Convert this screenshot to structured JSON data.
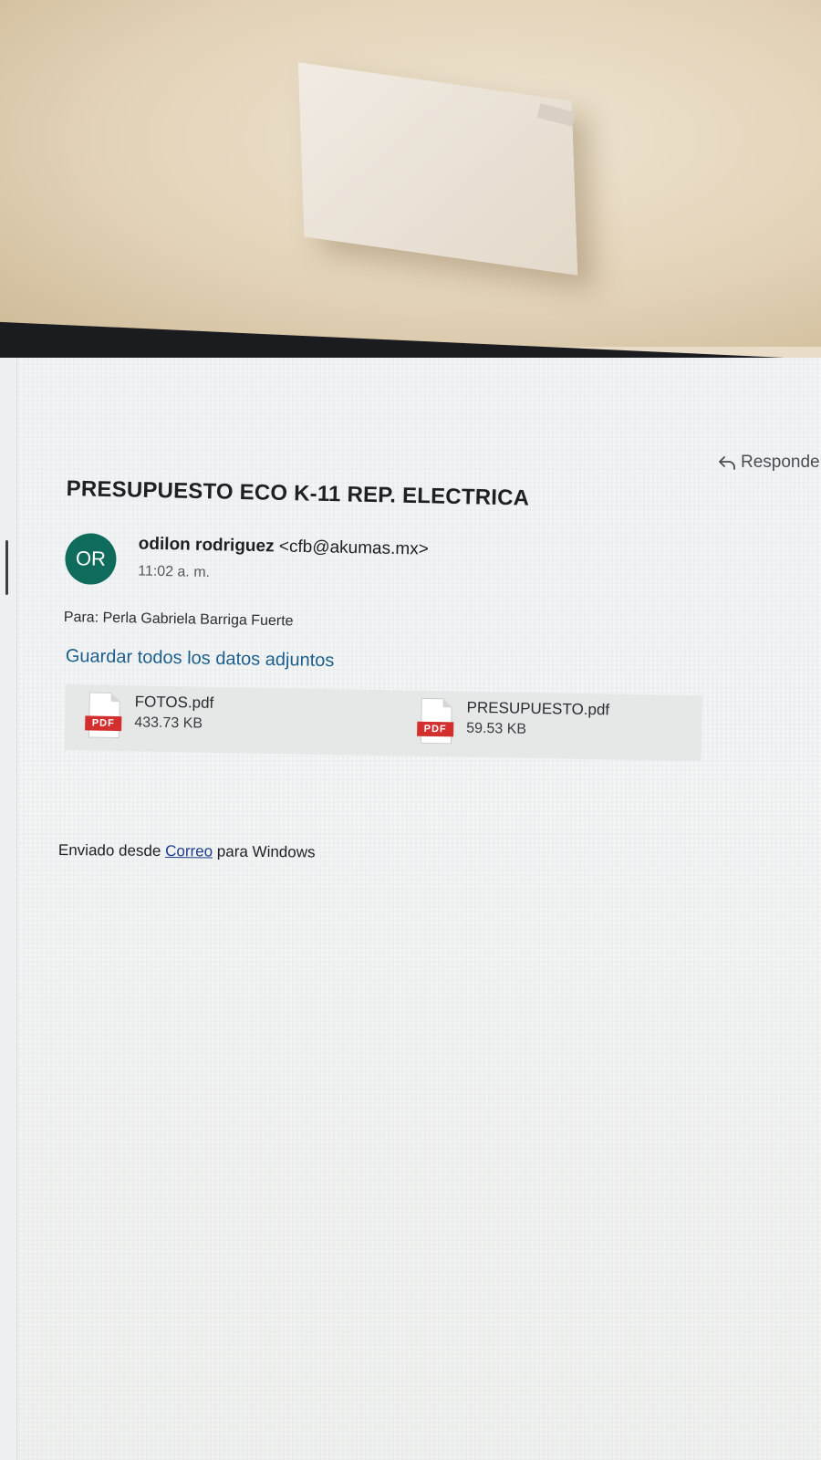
{
  "toolbar": {
    "reply_label": "Responde",
    "reply_icon": "reply-icon"
  },
  "email": {
    "subject": "PRESUPUESTO ECO K-11 REP. ELECTRICA",
    "sender": {
      "initials": "OR",
      "name": "odilon rodriguez",
      "address": "<cfb@akumas.mx>",
      "avatar_color": "#0f6b5b"
    },
    "time": "11:02 a. m.",
    "to_label": "Para:",
    "to_value": "Perla Gabriela Barriga Fuerte",
    "save_all_label": "Guardar todos los datos adjuntos",
    "attachments": [
      {
        "name": "FOTOS.pdf",
        "size": "433.73 KB",
        "type_label": "PDF"
      },
      {
        "name": "PRESUPUESTO.pdf",
        "size": "59.53 KB",
        "type_label": "PDF"
      }
    ],
    "signature": {
      "prefix": "Enviado desde",
      "link": "Correo",
      "suffix": "para Windows"
    }
  },
  "colors": {
    "accent_link": "#1b5e8c",
    "pdf_badge": "#d32f2f"
  }
}
